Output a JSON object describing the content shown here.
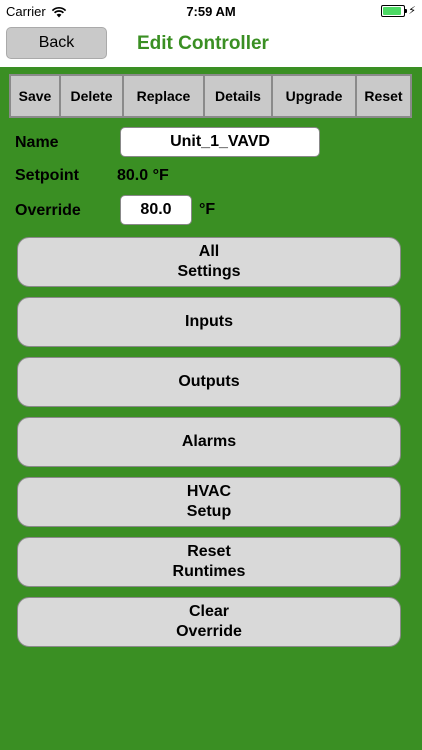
{
  "status_bar": {
    "carrier": "Carrier",
    "time": "7:59 AM",
    "battery_level": 1.0,
    "charging_icon": "bolt-icon"
  },
  "nav": {
    "back_label": "Back",
    "title": "Edit Controller"
  },
  "toolbar": {
    "buttons": [
      "Save",
      "Delete",
      "Replace",
      "Details",
      "Upgrade",
      "Reset"
    ]
  },
  "form": {
    "name_label": "Name",
    "name_value": "Unit_1_VAVD",
    "setpoint_label": "Setpoint",
    "setpoint_value": "80.0 °F",
    "override_label": "Override",
    "override_value": "80.0",
    "override_unit": "°F"
  },
  "menu": {
    "items": [
      "All\nSettings",
      "Inputs",
      "Outputs",
      "Alarms",
      "HVAC\nSetup",
      "Reset\nRuntimes",
      "Clear\nOverride"
    ]
  },
  "colors": {
    "background": "#3a8f23",
    "title": "#3a8f23",
    "button_gray": "#d9d9d9",
    "battery": "#4cd964"
  }
}
